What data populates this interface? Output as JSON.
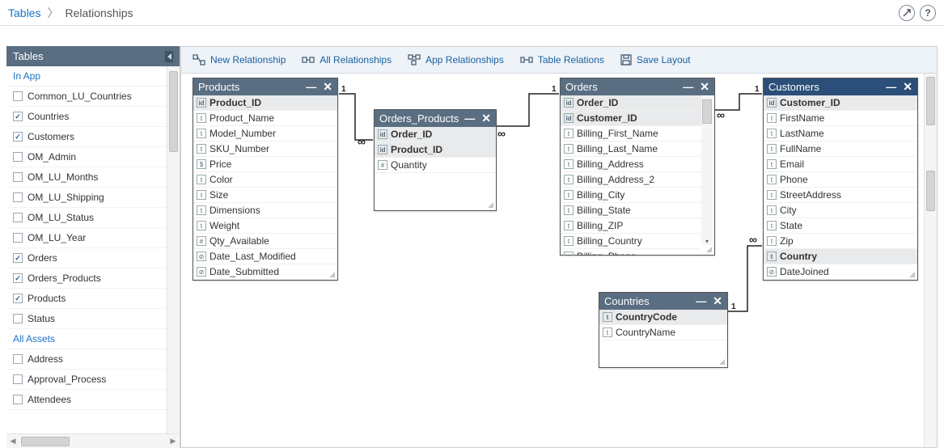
{
  "breadcrumb": {
    "root": "Tables",
    "current": "Relationships"
  },
  "header_icons": {
    "feedback": "◉",
    "help": "?"
  },
  "sidebar": {
    "title": "Tables",
    "section_in_app": "In App",
    "section_all_assets": "All Assets",
    "in_app_items": [
      {
        "label": "Common_LU_Countries",
        "checked": false
      },
      {
        "label": "Countries",
        "checked": true
      },
      {
        "label": "Customers",
        "checked": true
      },
      {
        "label": "OM_Admin",
        "checked": false
      },
      {
        "label": "OM_LU_Months",
        "checked": false
      },
      {
        "label": "OM_LU_Shipping",
        "checked": false
      },
      {
        "label": "OM_LU_Status",
        "checked": false
      },
      {
        "label": "OM_LU_Year",
        "checked": false
      },
      {
        "label": "Orders",
        "checked": true
      },
      {
        "label": "Orders_Products",
        "checked": true
      },
      {
        "label": "Products",
        "checked": true
      },
      {
        "label": "Status",
        "checked": false
      }
    ],
    "all_assets_items": [
      {
        "label": "Address",
        "checked": false
      },
      {
        "label": "Approval_Process",
        "checked": false
      },
      {
        "label": "Attendees",
        "checked": false
      }
    ]
  },
  "toolbar": {
    "new_rel": "New Relationship",
    "all_rel": "All Relationships",
    "app_rel": "App Relationships",
    "table_rel": "Table Relations",
    "save": "Save Layout"
  },
  "tables": {
    "products": {
      "title": "Products",
      "fields": [
        {
          "name": "Product_ID",
          "type": "id",
          "key": true
        },
        {
          "name": "Product_Name",
          "type": "t"
        },
        {
          "name": "Model_Number",
          "type": "t"
        },
        {
          "name": "SKU_Number",
          "type": "t"
        },
        {
          "name": "Price",
          "type": "$"
        },
        {
          "name": "Color",
          "type": "t"
        },
        {
          "name": "Size",
          "type": "t"
        },
        {
          "name": "Dimensions",
          "type": "t"
        },
        {
          "name": "Weight",
          "type": "t"
        },
        {
          "name": "Qty_Available",
          "type": "#"
        },
        {
          "name": "Date_Last_Modified",
          "type": "⊘"
        },
        {
          "name": "Date_Submitted",
          "type": "⊘"
        }
      ]
    },
    "orders_products": {
      "title": "Orders_Products",
      "fields": [
        {
          "name": "Order_ID",
          "type": "id",
          "key": true
        },
        {
          "name": "Product_ID",
          "type": "id",
          "key": true
        },
        {
          "name": "Quantity",
          "type": "#"
        }
      ]
    },
    "orders": {
      "title": "Orders",
      "fields": [
        {
          "name": "Order_ID",
          "type": "id",
          "key": true
        },
        {
          "name": "Customer_ID",
          "type": "id",
          "key": true
        },
        {
          "name": "Billing_First_Name",
          "type": "t"
        },
        {
          "name": "Billing_Last_Name",
          "type": "t"
        },
        {
          "name": "Billing_Address",
          "type": "t"
        },
        {
          "name": "Billing_Address_2",
          "type": "t"
        },
        {
          "name": "Billing_City",
          "type": "t"
        },
        {
          "name": "Billing_State",
          "type": "t"
        },
        {
          "name": "Billing_ZIP",
          "type": "t"
        },
        {
          "name": "Billing_Country",
          "type": "t"
        },
        {
          "name": "Billing_Phone",
          "type": "t"
        }
      ]
    },
    "customers": {
      "title": "Customers",
      "fields": [
        {
          "name": "Customer_ID",
          "type": "id",
          "key": true
        },
        {
          "name": "FirstName",
          "type": "t"
        },
        {
          "name": "LastName",
          "type": "t"
        },
        {
          "name": "FullName",
          "type": "t"
        },
        {
          "name": "Email",
          "type": "t"
        },
        {
          "name": "Phone",
          "type": "t"
        },
        {
          "name": "StreetAddress",
          "type": "t"
        },
        {
          "name": "City",
          "type": "t"
        },
        {
          "name": "State",
          "type": "t"
        },
        {
          "name": "Zip",
          "type": "t"
        },
        {
          "name": "Country",
          "type": "t",
          "hl": true
        },
        {
          "name": "DateJoined",
          "type": "⊘"
        }
      ]
    },
    "countries": {
      "title": "Countries",
      "fields": [
        {
          "name": "CountryCode",
          "type": "t",
          "key": true
        },
        {
          "name": "CountryName",
          "type": "t"
        }
      ]
    }
  }
}
